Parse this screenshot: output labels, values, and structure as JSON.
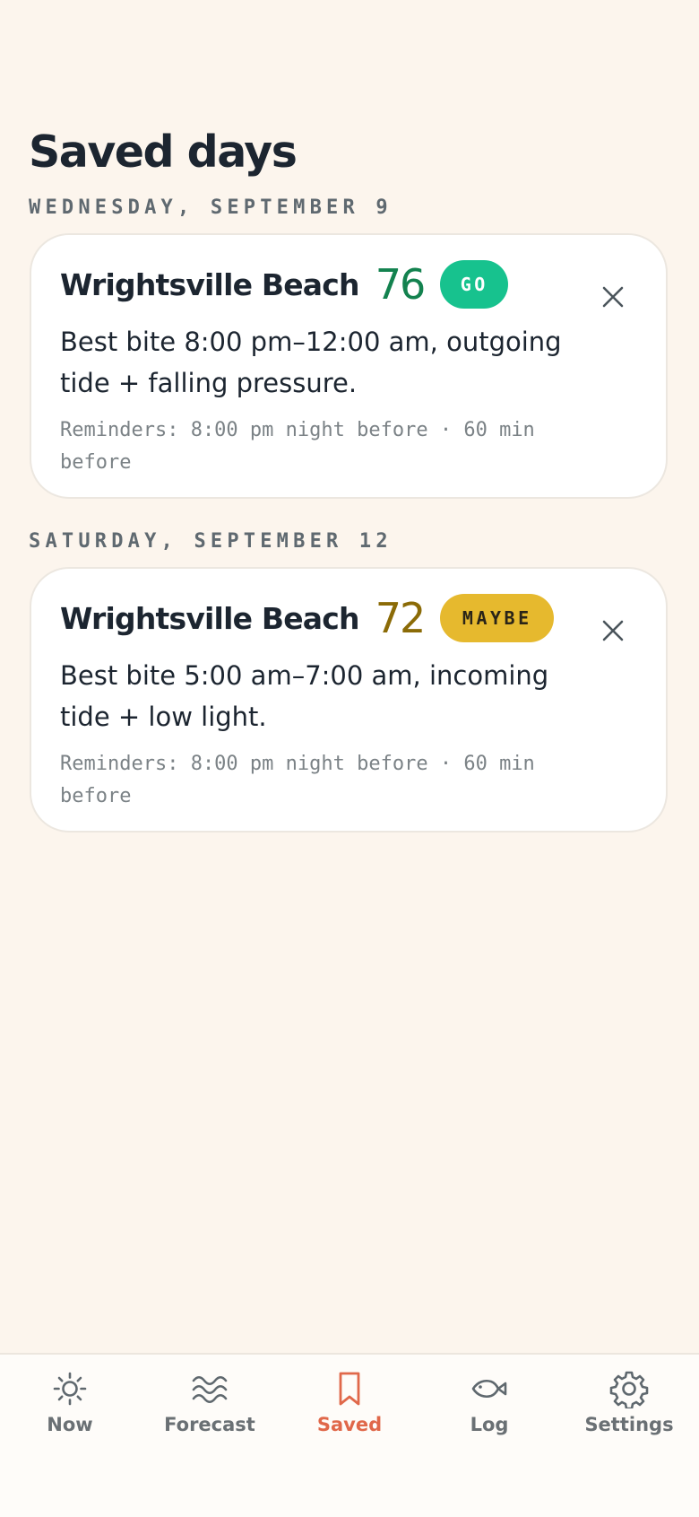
{
  "page": {
    "title": "Saved days"
  },
  "saved_days": [
    {
      "date": "WEDNESDAY, SEPTEMBER 9",
      "spot": "Wrightsville Beach",
      "score": "76",
      "score_color": "#13824f",
      "badge": "GO",
      "badge_color": "#17c28e",
      "summary": "Best bite 8:00 pm–12:00 am, outgoing tide + falling pressure.",
      "reminders": "Reminders: 8:00 pm night before · 60 min before",
      "close_icon": "close-icon"
    },
    {
      "date": "SATURDAY, SEPTEMBER 12",
      "spot": "Wrightsville Beach",
      "score": "72",
      "score_color": "#8b6b07",
      "badge": "MAYBE",
      "badge_color": "#e6b92e",
      "summary": "Best bite 5:00 am–7:00 am, incoming tide + low light.",
      "reminders": "Reminders: 8:00 pm night before · 60 min before",
      "close_icon": "close-icon"
    }
  ],
  "nav": {
    "active": "Saved",
    "active_color": "#e0684a",
    "items": [
      {
        "label": "Now",
        "icon": "sun-icon"
      },
      {
        "label": "Forecast",
        "icon": "waves-icon"
      },
      {
        "label": "Saved",
        "icon": "bookmark-icon"
      },
      {
        "label": "Log",
        "icon": "fish-icon"
      },
      {
        "label": "Settings",
        "icon": "gear-icon"
      }
    ]
  }
}
